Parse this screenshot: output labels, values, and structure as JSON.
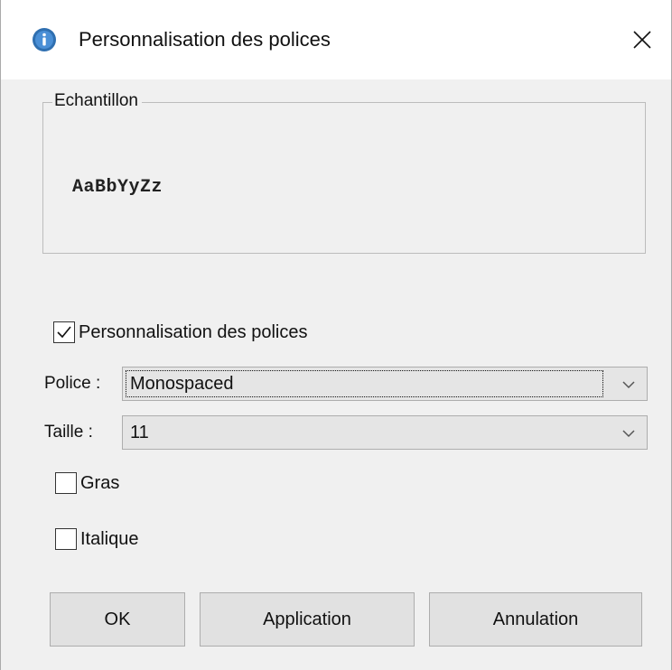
{
  "window": {
    "title": "Personnalisation des polices",
    "title_icon": "java-info-icon",
    "close_icon": "close-icon"
  },
  "sample": {
    "legend": "Echantillon",
    "text": "AaBbYyZz"
  },
  "custom_fonts": {
    "label": "Personnalisation des polices",
    "checked": true
  },
  "font": {
    "label": "Police :",
    "value": "Monospaced"
  },
  "size": {
    "label": "Taille :",
    "value": "11"
  },
  "bold": {
    "label": "Gras",
    "checked": false
  },
  "italic": {
    "label": "Italique",
    "checked": false
  },
  "buttons": {
    "ok": "OK",
    "apply": "Application",
    "cancel": "Annulation"
  },
  "colors": {
    "title_icon": "#2f6fb0",
    "window_bg": "#f0f0f0",
    "button_bg": "#e1e1e1"
  }
}
